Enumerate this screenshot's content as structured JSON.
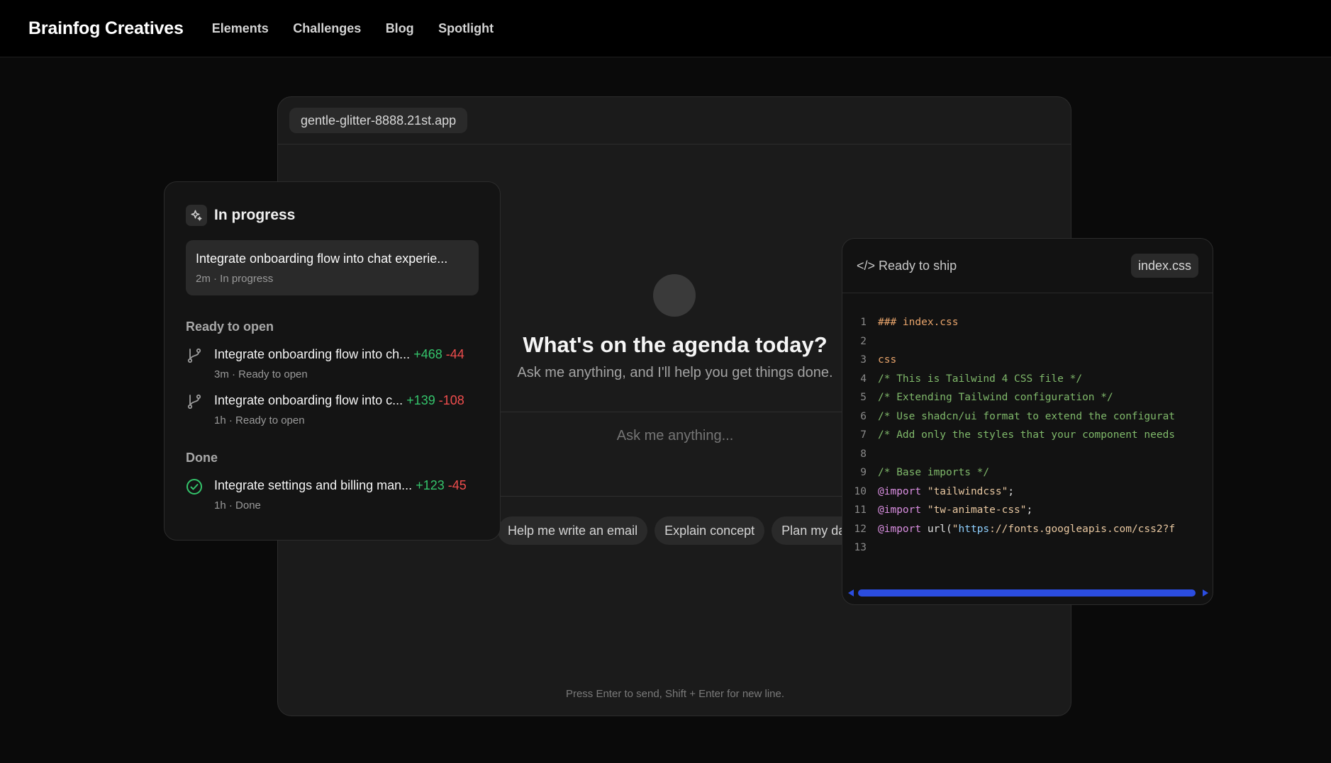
{
  "header": {
    "brand": "Brainfog Creatives",
    "nav": [
      "Elements",
      "Challenges",
      "Blog",
      "Spotlight"
    ]
  },
  "frame": {
    "url": "gentle-glitter-8888.21st.app",
    "headline": "What's on the agenda today?",
    "subline": "Ask me anything, and I'll help you get things done.",
    "input_placeholder": "Ask me anything...",
    "chips": [
      "Help me write an email",
      "Explain concept",
      "Plan my day"
    ],
    "hint": "Press Enter to send, Shift + Enter for new line."
  },
  "tasks": {
    "title": "In progress",
    "current": {
      "title": "Integrate onboarding flow into chat experie...",
      "meta": "2m · In progress"
    },
    "ready_label": "Ready to open",
    "ready": [
      {
        "title": "Integrate onboarding flow into ch...",
        "add": "+468",
        "del": "-44",
        "meta": "3m · Ready to open"
      },
      {
        "title": "Integrate onboarding flow into c...",
        "add": "+139",
        "del": "-108",
        "meta": "1h · Ready to open"
      }
    ],
    "done_label": "Done",
    "done": [
      {
        "title": "Integrate settings and billing man...",
        "add": "+123",
        "del": "-45",
        "meta": "1h · Done"
      }
    ]
  },
  "code": {
    "title": "</> Ready to ship",
    "file": "index.css",
    "lines": [
      {
        "n": "1",
        "parts": [
          [
            "c-orange",
            "### index.css"
          ]
        ]
      },
      {
        "n": "2",
        "parts": []
      },
      {
        "n": "3",
        "parts": [
          [
            "c-orange",
            "css"
          ]
        ]
      },
      {
        "n": "4",
        "parts": [
          [
            "c-green",
            "/* This is Tailwind 4 CSS file */"
          ]
        ]
      },
      {
        "n": "5",
        "parts": [
          [
            "c-green",
            "/* Extending Tailwind configuration */"
          ]
        ]
      },
      {
        "n": "6",
        "parts": [
          [
            "c-green",
            "/* Use shadcn/ui format to extend the configurat"
          ]
        ]
      },
      {
        "n": "7",
        "parts": [
          [
            "c-green",
            "/* Add only the styles that your component needs"
          ]
        ]
      },
      {
        "n": "8",
        "parts": []
      },
      {
        "n": "9",
        "parts": [
          [
            "c-green",
            "/* Base imports */"
          ]
        ]
      },
      {
        "n": "10",
        "parts": [
          [
            "c-pink",
            "@import"
          ],
          [
            "c-plain",
            " "
          ],
          [
            "c-str",
            "\"tailwindcss\""
          ],
          [
            "c-plain",
            ";"
          ]
        ]
      },
      {
        "n": "11",
        "parts": [
          [
            "c-pink",
            "@import"
          ],
          [
            "c-plain",
            " "
          ],
          [
            "c-str",
            "\"tw-animate-css\""
          ],
          [
            "c-plain",
            ";"
          ]
        ]
      },
      {
        "n": "12",
        "parts": [
          [
            "c-pink",
            "@import"
          ],
          [
            "c-plain",
            " url("
          ],
          [
            "c-str",
            "\""
          ],
          [
            "c-link",
            "https"
          ],
          [
            "c-str",
            "://fonts.googleapis.com/css2?f"
          ]
        ]
      },
      {
        "n": "13",
        "parts": []
      }
    ]
  },
  "colors": {
    "accent_add": "#34c46b",
    "accent_del": "#ef4d4d",
    "scrollbar": "#2b4de0"
  },
  "icons": {
    "tasks_header": "sparkles-icon",
    "ready": "git-branch-icon",
    "done": "check-circle-icon"
  }
}
